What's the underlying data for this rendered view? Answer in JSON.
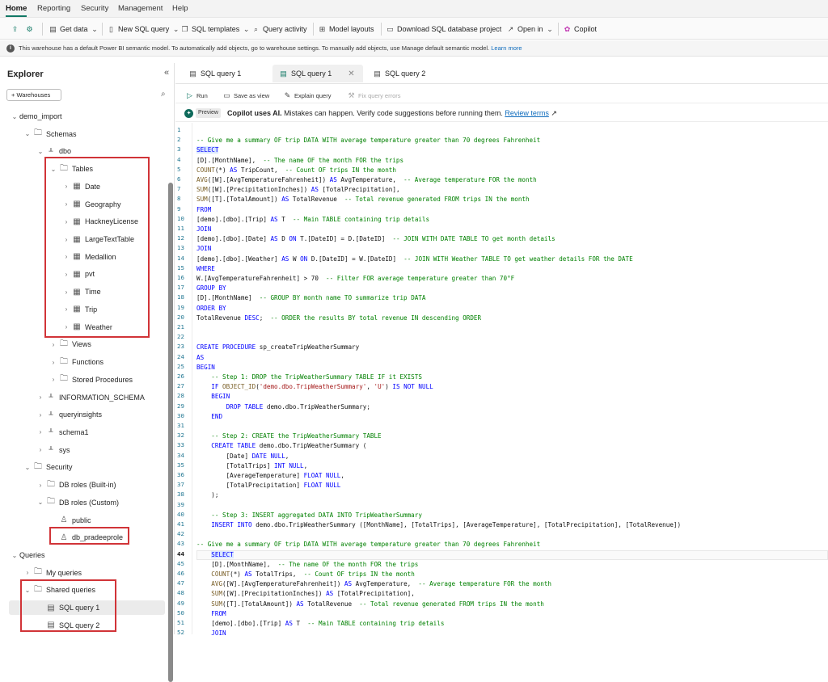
{
  "menu": {
    "tabs": [
      "Home",
      "Reporting",
      "Security",
      "Management",
      "Help"
    ],
    "active": "Home"
  },
  "toolbar": {
    "get_data": "Get data",
    "new_sql_query": "New SQL query",
    "sql_templates": "SQL templates",
    "query_activity": "Query activity",
    "model_layouts": "Model layouts",
    "download_project": "Download SQL database project",
    "open_in": "Open in",
    "copilot": "Copilot"
  },
  "info_bar": {
    "message": "This warehouse has a default Power BI semantic model. To automatically add objects, go to warehouse settings. To manually add objects, use Manage default semantic model.",
    "link": "Learn more"
  },
  "explorer": {
    "title": "Explorer",
    "warehouses_button": "+ Warehouses",
    "tree": [
      {
        "label": "demo_import",
        "level": 0,
        "chev": "open",
        "icon": ""
      },
      {
        "label": "Schemas",
        "level": 1,
        "chev": "open",
        "icon": "folder"
      },
      {
        "label": "dbo",
        "level": 2,
        "chev": "open",
        "icon": "schema"
      },
      {
        "label": "Tables",
        "level": 3,
        "chev": "open",
        "icon": "folder"
      },
      {
        "label": "Date",
        "level": 4,
        "chev": "closed",
        "icon": "table"
      },
      {
        "label": "Geography",
        "level": 4,
        "chev": "closed",
        "icon": "table"
      },
      {
        "label": "HackneyLicense",
        "level": 4,
        "chev": "closed",
        "icon": "table"
      },
      {
        "label": "LargeTextTable",
        "level": 4,
        "chev": "closed",
        "icon": "table"
      },
      {
        "label": "Medallion",
        "level": 4,
        "chev": "closed",
        "icon": "table"
      },
      {
        "label": "pvt",
        "level": 4,
        "chev": "closed",
        "icon": "table"
      },
      {
        "label": "Time",
        "level": 4,
        "chev": "closed",
        "icon": "table"
      },
      {
        "label": "Trip",
        "level": 4,
        "chev": "closed",
        "icon": "table"
      },
      {
        "label": "Weather",
        "level": 4,
        "chev": "closed",
        "icon": "table"
      },
      {
        "label": "Views",
        "level": 3,
        "chev": "closed",
        "icon": "folder"
      },
      {
        "label": "Functions",
        "level": 3,
        "chev": "closed",
        "icon": "folder"
      },
      {
        "label": "Stored Procedures",
        "level": 3,
        "chev": "closed",
        "icon": "folder"
      },
      {
        "label": "INFORMATION_SCHEMA",
        "level": 2,
        "chev": "closed",
        "icon": "schema"
      },
      {
        "label": "queryinsights",
        "level": 2,
        "chev": "closed",
        "icon": "schema"
      },
      {
        "label": "schema1",
        "level": 2,
        "chev": "closed",
        "icon": "schema"
      },
      {
        "label": "sys",
        "level": 2,
        "chev": "closed",
        "icon": "schema"
      },
      {
        "label": "Security",
        "level": 1,
        "chev": "open",
        "icon": "folder"
      },
      {
        "label": "DB roles (Built-in)",
        "level": 2,
        "chev": "closed",
        "icon": "folder"
      },
      {
        "label": "DB roles (Custom)",
        "level": 2,
        "chev": "open",
        "icon": "folder"
      },
      {
        "label": "public",
        "level": 3,
        "chev": "none",
        "icon": "role"
      },
      {
        "label": "db_pradeeprole",
        "level": 3,
        "chev": "none",
        "icon": "role"
      },
      {
        "label": "Queries",
        "level": 0,
        "chev": "open",
        "icon": ""
      },
      {
        "label": "My queries",
        "level": 1,
        "chev": "closed",
        "icon": "folder"
      },
      {
        "label": "Shared queries",
        "level": 1,
        "chev": "open",
        "icon": "folder"
      },
      {
        "label": "SQL query 1",
        "level": 2,
        "chev": "none",
        "icon": "query",
        "selected": true
      },
      {
        "label": "SQL query 2",
        "level": 2,
        "chev": "none",
        "icon": "query"
      }
    ]
  },
  "editor": {
    "tabs": [
      {
        "label": "SQL query 1",
        "active": false
      },
      {
        "label": "SQL query 1",
        "active": true
      },
      {
        "label": "SQL query 2",
        "active": false
      }
    ],
    "actions": {
      "run": "Run",
      "save_as_view": "Save as view",
      "explain_query": "Explain query",
      "fix_query_errors": "Fix query errors"
    },
    "copilot": {
      "badge": "Preview",
      "bold": "Copilot uses AI.",
      "text": " Mistakes can happen. Verify code suggestions before running them. ",
      "link": "Review terms"
    },
    "current_line": 44,
    "code": [
      "",
      "-- Give me a summary OF trip DATA WITH average temperature greater than 70 degrees Fahrenheit",
      "SELECT",
      "[D].[MonthName],  -- The name OF the month FOR the trips",
      "COUNT(*) AS TripCount,  -- Count OF trips IN the month",
      "AVG([W].[AvgTemperatureFahrenheit]) AS AvgTemperature,  -- Average temperature FOR the month",
      "SUM([W].[PrecipitationInches]) AS [TotalPrecipitation],",
      "SUM([T].[TotalAmount]) AS TotalRevenue  -- Total revenue generated FROM trips IN the month",
      "FROM",
      "[demo].[dbo].[Trip] AS T  -- Main TABLE containing trip details",
      "JOIN",
      "[demo].[dbo].[Date] AS D ON T.[DateID] = D.[DateID]  -- JOIN WITH DATE TABLE TO get month details",
      "JOIN",
      "[demo].[dbo].[Weather] AS W ON D.[DateID] = W.[DateID]  -- JOIN WITH Weather TABLE TO get weather details FOR the DATE",
      "WHERE",
      "W.[AvgTemperatureFahrenheit] > 70  -- Filter FOR average temperature greater than 70°F",
      "GROUP BY",
      "[D].[MonthName]  -- GROUP BY month name TO summarize trip DATA",
      "ORDER BY",
      "TotalRevenue DESC;  -- ORDER the results BY total revenue IN descending ORDER",
      "",
      "",
      "CREATE PROCEDURE sp_createTripWeatherSummary",
      "AS",
      "BEGIN",
      "    -- Step 1: DROP the TripWeatherSummary TABLE IF it EXISTS",
      "    IF OBJECT_ID('demo.dbo.TripWeatherSummary', 'U') IS NOT NULL",
      "    BEGIN",
      "        DROP TABLE demo.dbo.TripWeatherSummary;",
      "    END",
      "",
      "    -- Step 2: CREATE the TripWeatherSummary TABLE",
      "    CREATE TABLE demo.dbo.TripWeatherSummary (",
      "        [Date] DATE NULL,",
      "        [TotalTrips] INT NULL,",
      "        [AverageTemperature] FLOAT NULL,",
      "        [TotalPrecipitation] FLOAT NULL",
      "    );",
      "",
      "    -- Step 3: INSERT aggregated DATA INTO TripWeatherSummary",
      "    INSERT INTO demo.dbo.TripWeatherSummary ([MonthName], [TotalTrips], [AverageTemperature], [TotalPrecipitation], [TotalRevenue])",
      "",
      "-- Give me a summary OF trip DATA WITH average temperature greater than 70 degrees Fahrenheit",
      "    SELECT",
      "    [D].[MonthName],  -- The name OF the month FOR the trips",
      "    COUNT(*) AS TotalTrips,  -- Count OF trips IN the month",
      "    AVG([W].[AvgTemperatureFahrenheit]) AS AvgTemperature,  -- Average temperature FOR the month",
      "    SUM([W].[PrecipitationInches]) AS [TotalPrecipitation],",
      "    SUM([T].[TotalAmount]) AS TotalRevenue  -- Total revenue generated FROM trips IN the month",
      "    FROM",
      "    [demo].[dbo].[Trip] AS T  -- Main TABLE containing trip details",
      "    JOIN"
    ]
  }
}
